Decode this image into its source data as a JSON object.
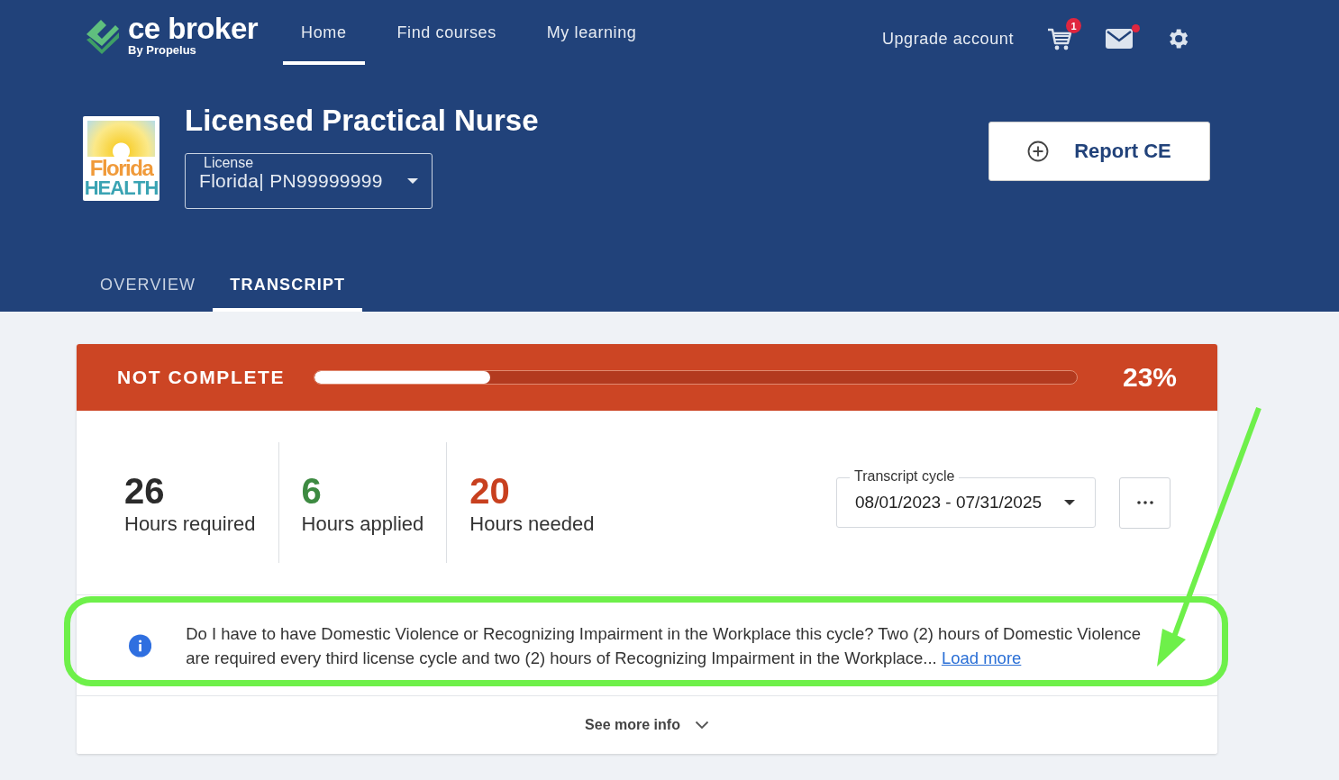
{
  "brand": {
    "name": "ce broker",
    "byline": "By Propelus"
  },
  "nav": [
    {
      "label": "Home",
      "selected": true
    },
    {
      "label": "Find courses",
      "selected": false
    },
    {
      "label": "My learning",
      "selected": false
    }
  ],
  "actions": {
    "upgrade": "Upgrade account",
    "cart_badge": "1",
    "mail_unread": true
  },
  "license": {
    "logo_lines": [
      "Florida",
      "HEALTH"
    ],
    "title": "Licensed Practical Nurse",
    "field_label": "License",
    "field_value": "Florida| PN99999999"
  },
  "report_button": "Report CE",
  "tabs": [
    {
      "label": "OVERVIEW",
      "selected": false
    },
    {
      "label": "TRANSCRIPT",
      "selected": true
    }
  ],
  "progress": {
    "status": "NOT COMPLETE",
    "level": 0.23,
    "reading": "23%"
  },
  "stats": [
    {
      "value": "26",
      "label": "Hours required",
      "color": "#2b2b2b"
    },
    {
      "value": "6",
      "label": "Hours applied",
      "color": "#3d8a41"
    },
    {
      "value": "20",
      "label": "Hours needed",
      "color": "#c8401f"
    }
  ],
  "cycle": {
    "label": "Transcript cycle",
    "value": "08/01/2023 - 07/31/2025"
  },
  "info": {
    "text": "Do I have to have Domestic Violence or Recognizing Impairment in the Workplace this cycle? Two (2) hours of Domestic Violence are required every third license cycle and two (2) hours of Recognizing Impairment in the Workplace...",
    "link": "Load more"
  },
  "see_more": "See more info"
}
